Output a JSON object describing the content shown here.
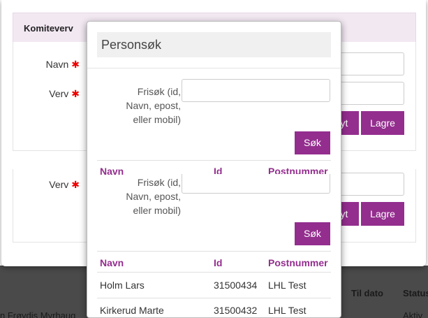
{
  "background": {
    "table_headers": [
      "Til dato",
      "Status"
    ],
    "row_cells": [
      "n Frøydis Myrhaug",
      "Aktiv"
    ]
  },
  "outer": {
    "title": "Komiteverv",
    "fields": [
      {
        "label": "Navn",
        "required": "✱"
      },
      {
        "label": "Verv",
        "required": "✱"
      },
      {
        "label": "Verv",
        "required": "✱"
      }
    ],
    "buttons": {
      "cancel_partial": "yt",
      "save": "Lagre"
    }
  },
  "search": {
    "title": "Personsøk",
    "label": "Frisøk (id, Navn, epost, eller mobil)",
    "label_lines": [
      "Frisøk (id,",
      "Navn, epost,",
      "eller mobil)"
    ],
    "button": "Søk",
    "columns": [
      "Navn",
      "Id",
      "Postnummer"
    ],
    "rows": [
      {
        "name": "Holm Lars",
        "id": "31500434",
        "postnr": "LHL Test"
      },
      {
        "name": "Kirkerud Marte",
        "id": "31500432",
        "postnr": "LHL Test"
      }
    ]
  },
  "colors": {
    "accent": "#932e8e",
    "required": "#e00000",
    "header_bg": "#f2e8f2"
  }
}
